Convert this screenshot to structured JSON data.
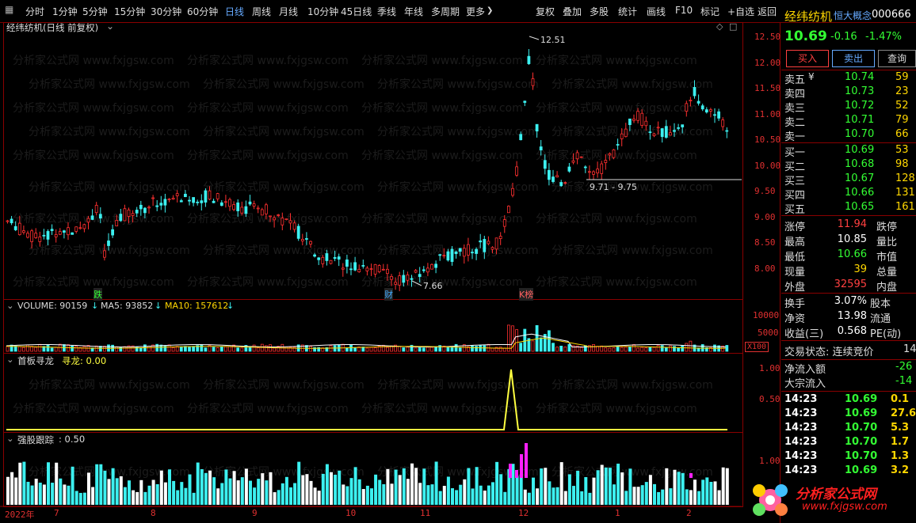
{
  "toolbar": {
    "periods": [
      "分时",
      "1分钟",
      "5分钟",
      "15分钟",
      "30分钟",
      "60分钟",
      "日线",
      "周线",
      "月线",
      "10分钟",
      "45日线",
      "季线",
      "年线",
      "多周期",
      "更多"
    ],
    "active_period": "日线",
    "more_arrow": "❯",
    "actions": [
      "复权",
      "叠加",
      "多股",
      "统计",
      "画线",
      "F10",
      "标记",
      "+自选",
      "返回"
    ]
  },
  "chart": {
    "title": "经纬纺机(日线 前复权)",
    "collapse_glyph": "⌄",
    "price_ticks": [
      "12.50",
      "12.00",
      "11.50",
      "11.00",
      "10.50",
      "10.00",
      "9.50",
      "9.00",
      "8.50",
      "8.00"
    ],
    "high_label": "12.51",
    "low_label": "7.66",
    "range_label": "9.71 - 9.75",
    "events": [
      "跌",
      "财",
      "K榜"
    ],
    "colors": {
      "up": "#ff3030",
      "down": "#3cf0f0",
      "grid": "#8a0000",
      "axis": "#e03030",
      "ma": "#ffffff",
      "ma2": "#ffd700",
      "signal": "#ffff40",
      "magenta": "#ff20ff"
    }
  },
  "volume": {
    "label": "VOLUME: 90159",
    "ma5": "MA5: 93852",
    "ma10": "MA10: 157612",
    "ticks": [
      "10000",
      "5000"
    ],
    "unit": "X100"
  },
  "indicator1": {
    "name": "首板寻龙",
    "value_label": "寻龙: 0.00",
    "ticks": [
      "1.00",
      "0.50"
    ]
  },
  "indicator2": {
    "name": "强股跟踪",
    "value_label": ": 0.50",
    "ticks": [
      "1.00"
    ]
  },
  "date_axis": {
    "labels": [
      "2022年",
      "7",
      "8",
      "9",
      "10",
      "11",
      "12",
      "1",
      "2"
    ]
  },
  "quote": {
    "name": "经纬纺机",
    "concept": "恒大概念",
    "code": "000666",
    "price": "10.69",
    "change": "-0.16",
    "change_pct": "-1.47%",
    "buttons": [
      "买入",
      "卖出",
      "查询"
    ],
    "asks": [
      {
        "label": "卖五",
        "price": "10.74",
        "vol": "59"
      },
      {
        "label": "卖四",
        "price": "10.73",
        "vol": "23"
      },
      {
        "label": "卖三",
        "price": "10.72",
        "vol": "52"
      },
      {
        "label": "卖二",
        "price": "10.71",
        "vol": "79"
      },
      {
        "label": "卖一",
        "price": "10.70",
        "vol": "66"
      }
    ],
    "ask5_flag": "¥",
    "bids": [
      {
        "label": "买一",
        "price": "10.69",
        "vol": "53"
      },
      {
        "label": "买二",
        "price": "10.68",
        "vol": "98"
      },
      {
        "label": "买三",
        "price": "10.67",
        "vol": "128"
      },
      {
        "label": "买四",
        "price": "10.66",
        "vol": "131"
      },
      {
        "label": "买五",
        "price": "10.65",
        "vol": "161"
      }
    ],
    "stats": [
      {
        "l": "涨停",
        "v": "11.94",
        "r": "跌停"
      },
      {
        "l": "最高",
        "v": "10.85",
        "r": "量比"
      },
      {
        "l": "最低",
        "v": "10.66",
        "r": "市值"
      },
      {
        "l": "现量",
        "v": "39",
        "r": "总量"
      },
      {
        "l": "外盘",
        "v": "32595",
        "r": "内盘"
      }
    ],
    "stats2": [
      {
        "l": "换手",
        "v": "3.07%",
        "r": "股本"
      },
      {
        "l": "净资",
        "v": "13.98",
        "r": "流通"
      },
      {
        "l": "收益(三)",
        "v": "0.568",
        "r": "PE(动)"
      }
    ],
    "status_label": "交易状态: 连续竞价",
    "status_time": "14:",
    "flows": [
      {
        "l": "净流入额",
        "v": "-26"
      },
      {
        "l": "大宗流入",
        "v": "-14"
      }
    ],
    "ticks": [
      {
        "t": "14:23",
        "p": "10.69",
        "v": "0.1"
      },
      {
        "t": "14:23",
        "p": "10.69",
        "v": "27.6"
      },
      {
        "t": "14:23",
        "p": "10.70",
        "v": "5.3"
      },
      {
        "t": "14:23",
        "p": "10.70",
        "v": "1.7"
      },
      {
        "t": "14:23",
        "p": "10.70",
        "v": "1.3"
      },
      {
        "t": "14:23",
        "p": "10.69",
        "v": "3.2"
      }
    ]
  },
  "watermark": {
    "text": "分析家公式网 www.fxjgsw.com",
    "logo": "分析家公式网",
    "url": "www.fxjgsw.com"
  }
}
